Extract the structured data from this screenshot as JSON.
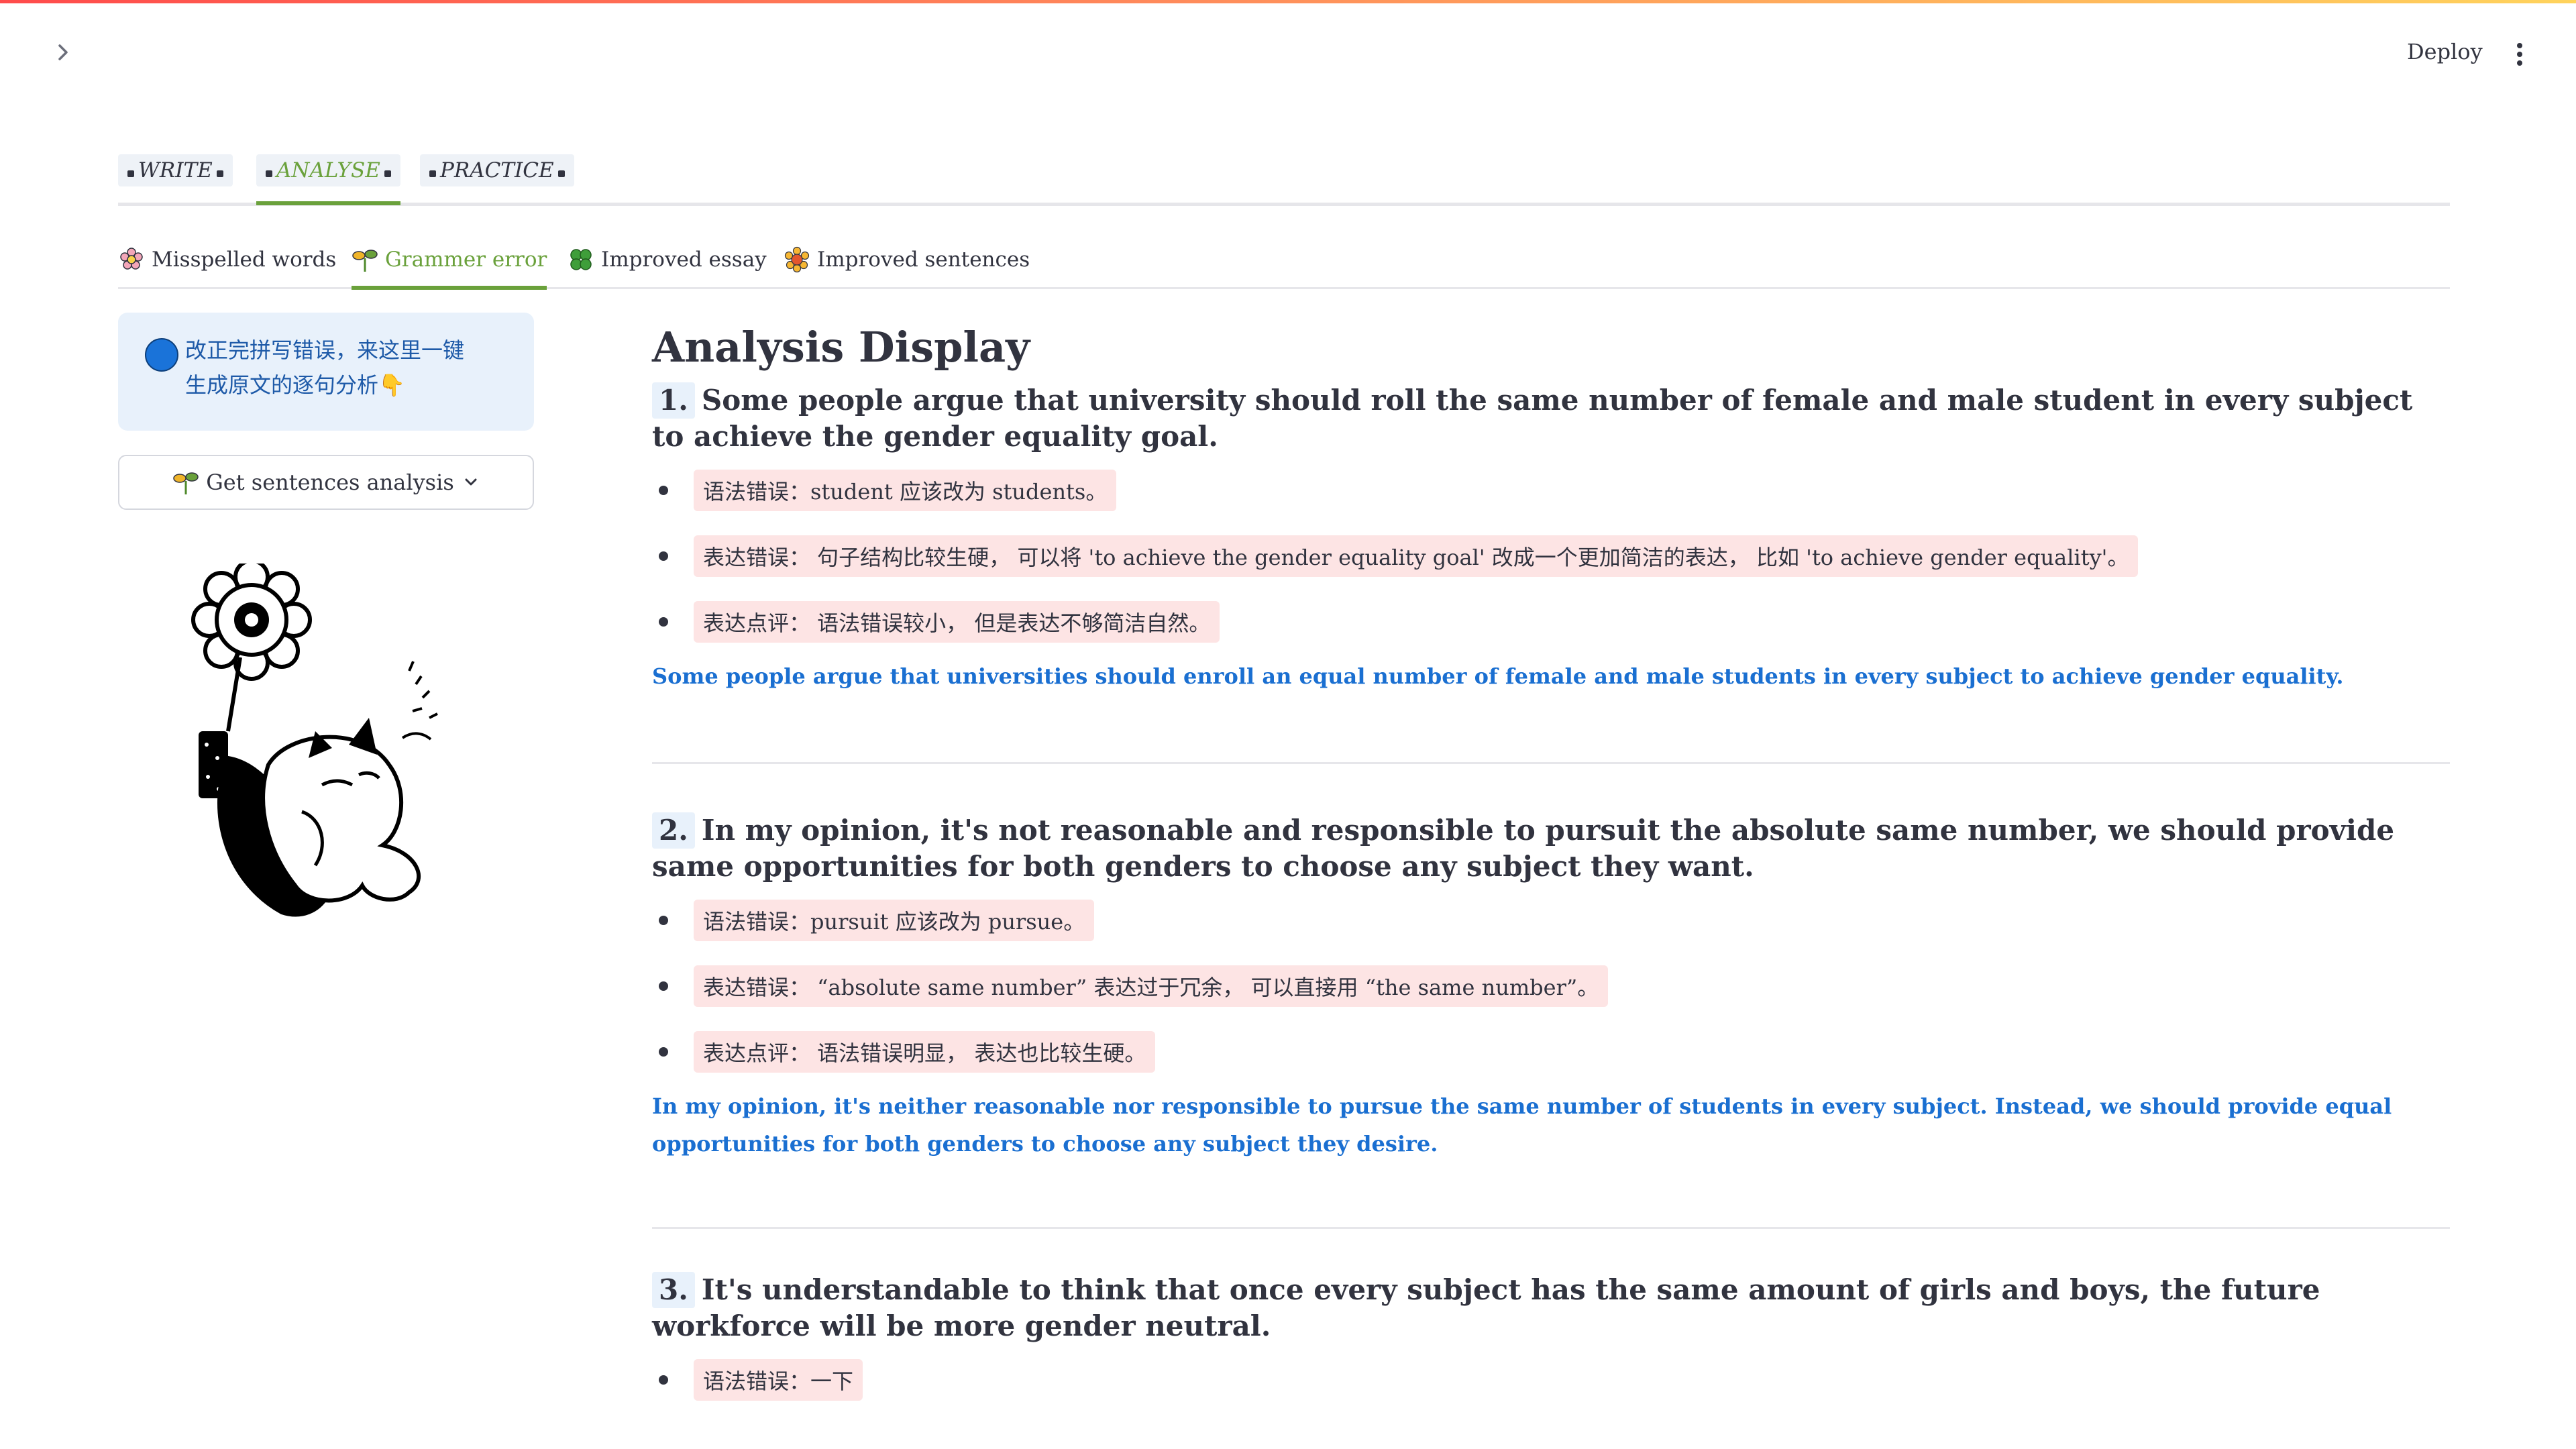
{
  "header": {
    "deploy_label": "Deploy"
  },
  "main_tabs": [
    {
      "label": "WRITE"
    },
    {
      "label": "ANALYSE"
    },
    {
      "label": "PRACTICE"
    }
  ],
  "sub_tabs": [
    {
      "label": "Misspelled words",
      "icon": "flower-icon"
    },
    {
      "label": "Grammer error",
      "icon": "sprout-icon"
    },
    {
      "label": "Improved essay",
      "icon": "clover-icon"
    },
    {
      "label": "Improved sentences",
      "icon": "sunflower-icon"
    }
  ],
  "sidebar": {
    "info_line1": "改正完拼写错误，来这里一键",
    "info_line2": "生成原文的逐句分析👇",
    "button_label": "Get sentences analysis"
  },
  "analysis": {
    "heading": "Analysis Display",
    "items": [
      {
        "num": "1.",
        "title": "Some people argue that university should roll the same number of female and male student in every subject to achieve the gender equality goal.",
        "notes": [
          "语法错误：student 应该改为 students。",
          "表达错误： 句子结构比较生硬， 可以将 'to achieve the gender equality goal' 改成一个更加简洁的表达， 比如 'to achieve gender equality'。",
          "表达点评： 语法错误较小， 但是表达不够简洁自然。"
        ],
        "improved": "Some people argue that universities should enroll an equal number of female and male students in every subject to achieve gender equality."
      },
      {
        "num": "2.",
        "title": "In my opinion, it's not reasonable and responsible to pursuit the absolute same number, we should provide same opportunities for both genders to choose any subject they want.",
        "notes": [
          "语法错误：pursuit 应该改为 pursue。",
          "表达错误： “absolute same number” 表达过于冗余， 可以直接用 “the same number”。",
          "表达点评： 语法错误明显， 表达也比较生硬。"
        ],
        "improved": "In my opinion, it's neither reasonable nor responsible to pursue the same number of students in every subject. Instead, we should provide equal opportunities for both genders to choose any subject they desire."
      },
      {
        "num": "3.",
        "title": "It's understandable to think that once every subject has the same amount of girls and boys, the future workforce will be more gender neutral.",
        "notes": [
          "语法错误：一下"
        ],
        "improved": ""
      }
    ]
  },
  "colors": {
    "accent_green": "#6aa13b",
    "improved_blue": "#1a6fd1",
    "note_bg": "#fde4e4",
    "info_bg": "#e8f1fb"
  }
}
